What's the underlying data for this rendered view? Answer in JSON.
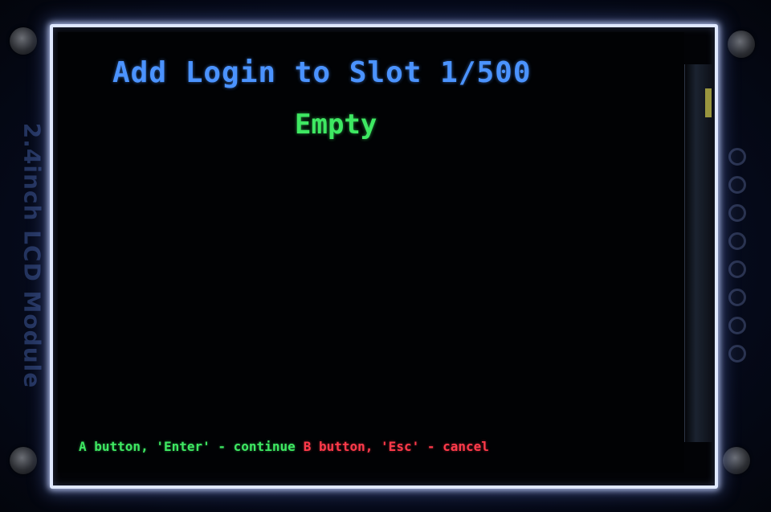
{
  "board": {
    "label": "2.4inch LCD Module"
  },
  "screen": {
    "title": "Add Login to Slot 1/500",
    "slot_status": "Empty",
    "hints": {
      "continue": "A button, 'Enter' - continue",
      "cancel": "B button, 'Esc' - cancel"
    }
  },
  "colors": {
    "title": "#4b93ff",
    "status": "#3ee862",
    "continue_hint": "#3ee862",
    "cancel_hint": "#ff3a4a"
  }
}
